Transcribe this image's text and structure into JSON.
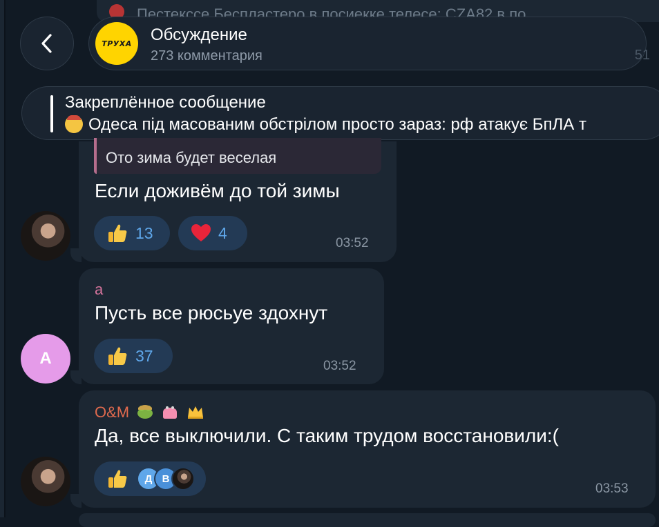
{
  "header": {
    "back_label": "Back",
    "title": "Обсуждение",
    "subtitle": "273 комментария",
    "logo_text": "ТРУХА",
    "side_fragment": "51"
  },
  "top_ghost": {
    "text": "Пестекссе Беспластеро в посиекке телесе: СZА82 в по..."
  },
  "pinned": {
    "title": "Закреплённое сообщение",
    "text": "Одеса під масованим обстрілом просто зараз: рф атакує БпЛА т"
  },
  "messages": [
    {
      "reply_quote": "Ото зима будет веселая",
      "text": "Если доживём до той зимы",
      "reactions": [
        {
          "icon": "thumbs-up",
          "count": "13"
        },
        {
          "icon": "heart",
          "count": "4"
        }
      ],
      "time": "03:52"
    },
    {
      "author": "а",
      "author_color": "#d3739b",
      "avatar_letter": "A",
      "text": "Пусть все рюсьуе здохнут",
      "reactions": [
        {
          "icon": "thumbs-up",
          "count": "37"
        }
      ],
      "time": "03:52"
    },
    {
      "author": "O&M",
      "author_color": "#e06a4e",
      "text": "Да, все выключили. С таким трудом восстановили:(",
      "reactions": [
        {
          "icon": "thumbs-up",
          "reactor_initials": [
            "Д",
            "В"
          ]
        }
      ],
      "time": "03:53"
    }
  ],
  "colors": {
    "background": "#111a24",
    "bubble": "#1c2733",
    "reaction_bg": "#233a55",
    "reaction_text": "#5fa7ea",
    "logo_yellow": "#ffd400"
  }
}
